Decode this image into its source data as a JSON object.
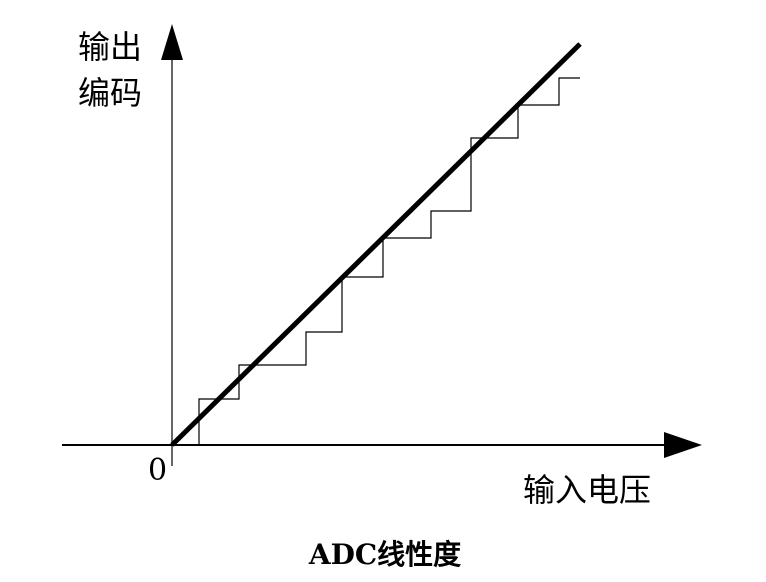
{
  "diagram": {
    "y_axis_label_line1": "输出",
    "y_axis_label_line2": "编码",
    "x_axis_label": "输入电压",
    "origin_label": "0",
    "caption": "ADC线性度"
  }
}
